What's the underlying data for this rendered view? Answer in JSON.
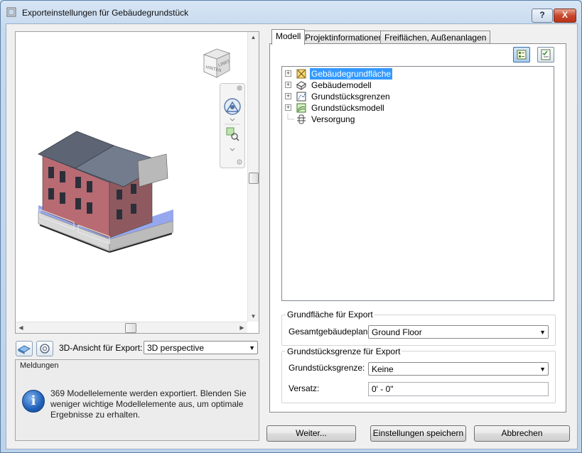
{
  "window": {
    "title": "Exporteinstellungen für Gebäudegrundstück",
    "help_label": "?",
    "close_label": "X"
  },
  "viewport": {
    "viewcube_faces": [
      "HINTEN",
      "LINKS"
    ]
  },
  "view_controls": {
    "export_view_label": "3D-Ansicht für Export:",
    "export_view_value": "3D perspective"
  },
  "messages": {
    "title": "Meldungen",
    "text": "369 Modellelemente werden exportiert. Blenden Sie weniger wichtige Modellelemente aus, um optimale Ergebnisse zu erhalten.",
    "icon": "info-icon"
  },
  "tabs": [
    {
      "label": "Modell",
      "active": true
    },
    {
      "label": "Projektinformationen",
      "active": false
    },
    {
      "label": "Freiflächen, Außenanlagen",
      "active": false
    }
  ],
  "tree": {
    "items": [
      {
        "label": "Gebäudegrundfläche",
        "selected": true,
        "expandable": true,
        "icon": "footprint-icon"
      },
      {
        "label": "Gebäudemodell",
        "selected": false,
        "expandable": true,
        "icon": "building-model-icon"
      },
      {
        "label": "Grundstücksgrenzen",
        "selected": false,
        "expandable": true,
        "icon": "property-line-icon"
      },
      {
        "label": "Grundstücksmodell",
        "selected": false,
        "expandable": true,
        "icon": "site-model-icon"
      },
      {
        "label": "Versorgung",
        "selected": false,
        "expandable": false,
        "icon": "utility-icon"
      }
    ]
  },
  "footprint_group": {
    "title": "Grundfläche für Export",
    "plan_label": "Gesamtgebäudeplan:",
    "plan_value": "Ground Floor"
  },
  "property_group": {
    "title": "Grundstücksgrenze für Export",
    "line_label": "Grundstücksgrenze:",
    "line_value": "Keine",
    "offset_label": "Versatz:",
    "offset_value": "0' - 0\""
  },
  "buttons": {
    "next": "Weiter...",
    "save_settings": "Einstellungen speichern",
    "cancel": "Abbrechen"
  },
  "colors": {
    "selection": "#3399ff",
    "title_gradient": "#c6d9ee",
    "close_button": "#c8482c"
  }
}
